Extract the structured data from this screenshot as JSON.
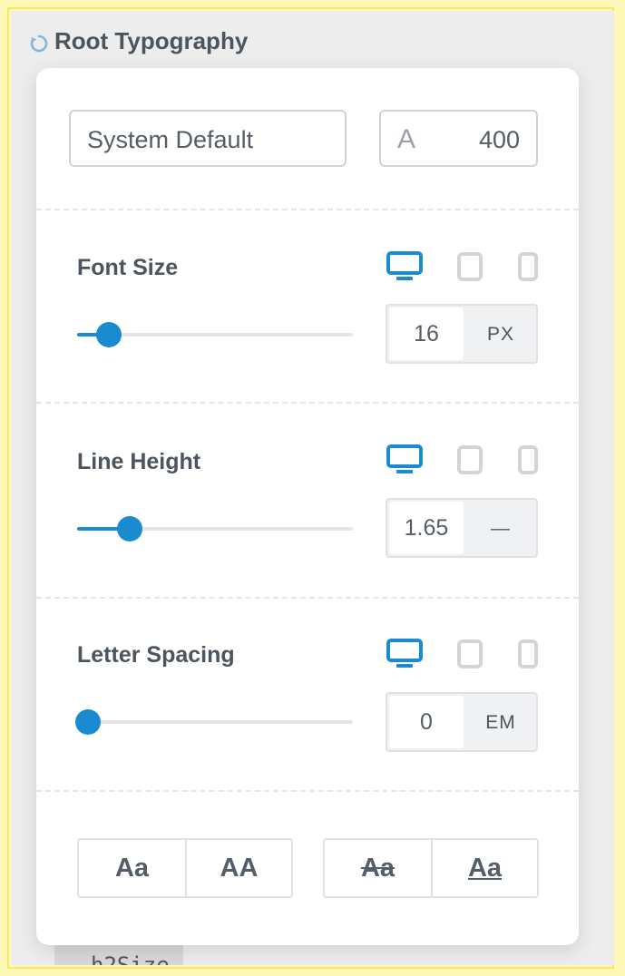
{
  "section": {
    "title": "Root Typography",
    "reset_icon": "reset-icon"
  },
  "font": {
    "family": "System Default",
    "weight_icon": "A",
    "weight": "400"
  },
  "controls": [
    {
      "label": "Font Size",
      "value": "16",
      "unit": "PX",
      "slider_fraction": 0.115,
      "active_device": "desktop"
    },
    {
      "label": "Line Height",
      "value": "1.65",
      "unit": "—",
      "slider_fraction": 0.19,
      "active_device": "desktop"
    },
    {
      "label": "Letter Spacing",
      "value": "0",
      "unit": "EM",
      "slider_fraction": 0.04,
      "active_device": "desktop"
    }
  ],
  "devices": [
    "desktop-icon",
    "tablet-icon",
    "mobile-icon"
  ],
  "text_transform": {
    "capitalize": "Aa",
    "uppercase": "AA"
  },
  "text_decoration": {
    "strikethrough": "Aa",
    "underline": "Aa"
  },
  "colors": {
    "accent": "#1a8bd0",
    "inactive": "#d2d4d7",
    "text": "#4c555e"
  },
  "behind_text": "h2Size"
}
